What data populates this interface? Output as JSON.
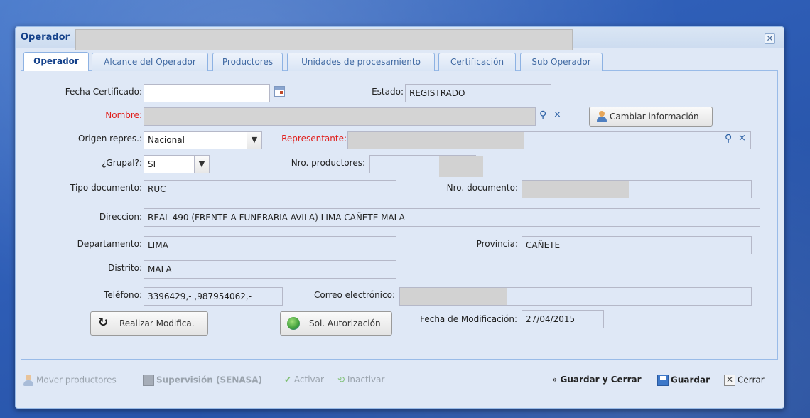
{
  "window": {
    "title": "Operador"
  },
  "tabs": [
    {
      "label": "Operador"
    },
    {
      "label": "Alcance del Operador"
    },
    {
      "label": "Productores"
    },
    {
      "label": "Unidades de procesamiento"
    },
    {
      "label": "Certificación"
    },
    {
      "label": "Sub Operador"
    }
  ],
  "form": {
    "fecha_certificado": {
      "label": "Fecha Certificado:",
      "value": ""
    },
    "estado": {
      "label": "Estado:",
      "value": "REGISTRADO"
    },
    "nombre": {
      "label": "Nombre:",
      "value": ""
    },
    "cambiar_info": {
      "label": "Cambiar información"
    },
    "origen": {
      "label": "Origen repres.:",
      "value": "Nacional"
    },
    "representante": {
      "label": "Representante:",
      "value": ""
    },
    "grupal": {
      "label": "¿Grupal?:",
      "value": "SI"
    },
    "nro_productores": {
      "label": "Nro. productores:",
      "value": ""
    },
    "tipo_documento": {
      "label": "Tipo documento:",
      "value": "RUC"
    },
    "nro_documento": {
      "label": "Nro. documento:",
      "value": ""
    },
    "direccion": {
      "label": "Direccion:",
      "value": "REAL  490 (FRENTE A FUNERARIA AVILA) LIMA CAÑETE MALA"
    },
    "departamento": {
      "label": "Departamento:",
      "value": "LIMA"
    },
    "provincia": {
      "label": "Provincia:",
      "value": "CAÑETE"
    },
    "distrito": {
      "label": "Distrito:",
      "value": "MALA"
    },
    "telefono": {
      "label": "Teléfono:",
      "value": "3396429,- ,987954062,-"
    },
    "correo": {
      "label": "Correo electrónico:",
      "value": ""
    },
    "realizar_modifica": {
      "label": "Realizar Modifica."
    },
    "sol_autorizacion": {
      "label": "Sol. Autorización"
    },
    "fecha_modificacion": {
      "label": "Fecha de Modificación:",
      "value": "27/04/2015"
    }
  },
  "toolbar": {
    "mover_productores": "Mover productores",
    "supervision": "Supervisión (SENASA)",
    "activar": "Activar",
    "inactivar": "Inactivar",
    "guardar_cerrar": "Guardar y Cerrar",
    "guardar": "Guardar",
    "cerrar": "Cerrar"
  },
  "colors": {
    "required_label": "#e0201d",
    "title_text": "#15428b",
    "panel_bg": "#dfe8f6"
  }
}
